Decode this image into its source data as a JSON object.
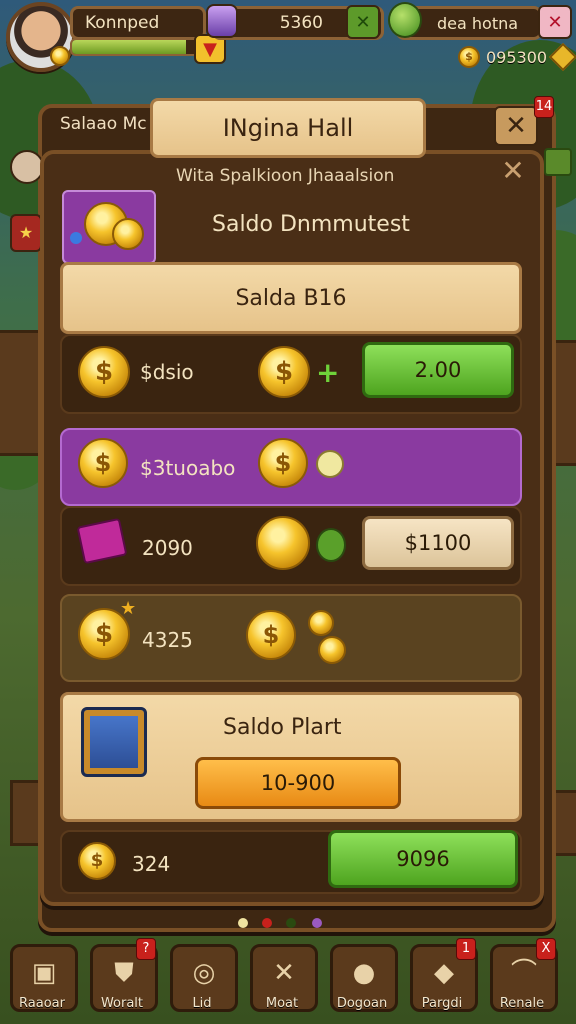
{
  "player": {
    "name": "Konnped",
    "xp_fraction": 0.85
  },
  "resources": {
    "gems": "5360",
    "energy_label": "dea hotna",
    "coins": "095300",
    "top_badge": "14"
  },
  "side_panel": {
    "title": "Salaao Mc"
  },
  "dialog": {
    "title": "INgina Hall",
    "subtitle": "Wita Spalkioon Jhaaalsion",
    "section_title": "Saldo Dnmmutest",
    "balance_banner": "Salda B16",
    "rows": [
      {
        "amount": "$dsio",
        "action": "2.00"
      },
      {
        "amount": "$3tuoabo"
      },
      {
        "amount": "2090",
        "action": "$1100"
      },
      {
        "amount": "4325"
      }
    ],
    "plant_title": "Saldo Plart",
    "plant_button": "10-900",
    "bottom_amount": "324",
    "bottom_button": "9096"
  },
  "nav": [
    {
      "label": "Raaoar",
      "icon": "chest-icon"
    },
    {
      "label": "Woralt",
      "icon": "shield-icon",
      "badge": "?"
    },
    {
      "label": "Lid",
      "icon": "disc-icon"
    },
    {
      "label": "Moat",
      "icon": "swords-icon"
    },
    {
      "label": "Dogoan",
      "icon": "bag-icon"
    },
    {
      "label": "Pargdi",
      "icon": "gem-icon",
      "badge": "1"
    },
    {
      "label": "Renale",
      "icon": "helmet-icon",
      "badge": "X"
    }
  ],
  "colors": {
    "accent_green": "#4ea41f",
    "panel_brown": "#4a2e16",
    "purple_row": "#8a3aa0",
    "close_red": "#c8211c"
  }
}
